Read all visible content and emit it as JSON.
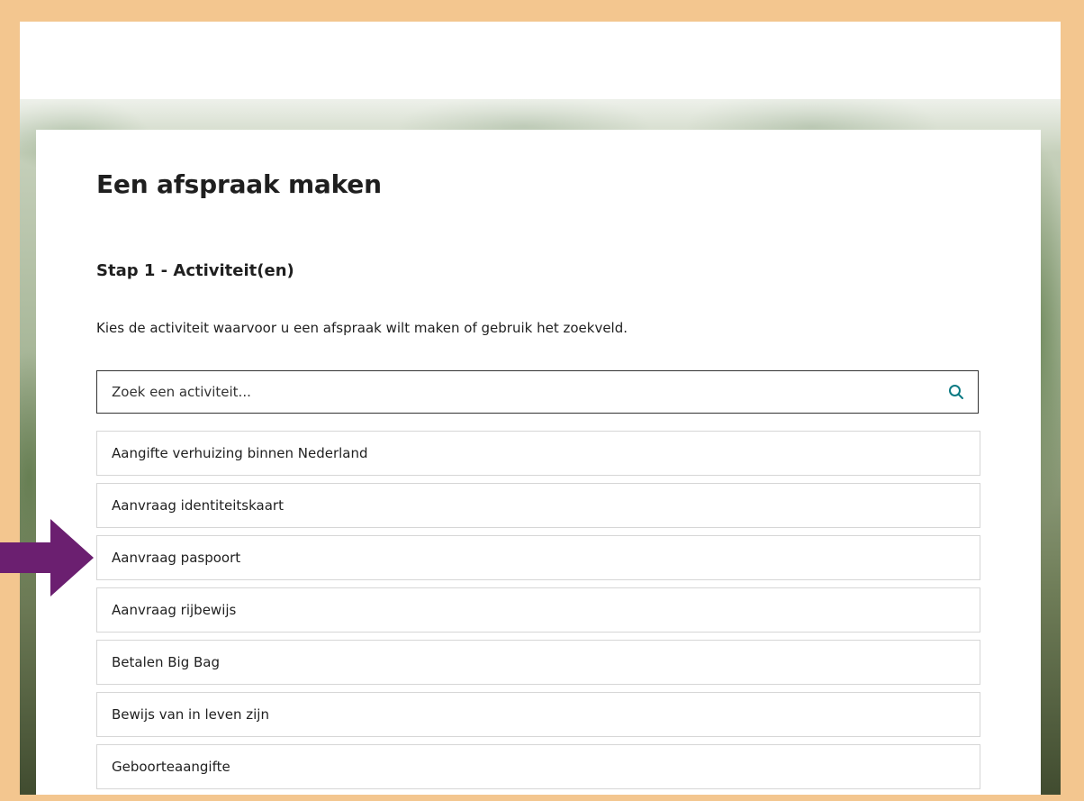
{
  "page": {
    "title": "Een afspraak maken",
    "step_title": "Stap 1 - Activiteit(en)",
    "instruction": "Kies de activiteit waarvoor u een afspraak wilt maken of gebruik het zoekveld."
  },
  "search": {
    "placeholder": "Zoek een activiteit...",
    "value": "",
    "icon": "search-icon"
  },
  "activities": [
    {
      "label": "Aangifte verhuizing binnen Nederland"
    },
    {
      "label": "Aanvraag identiteitskaart"
    },
    {
      "label": "Aanvraag paspoort"
    },
    {
      "label": "Aanvraag rijbewijs"
    },
    {
      "label": "Betalen Big Bag"
    },
    {
      "label": "Bewijs van in leven zijn"
    },
    {
      "label": "Geboorteaangifte"
    }
  ],
  "annotation": {
    "icon": "arrow-right-icon",
    "color": "#6b1f70",
    "points_to": "Aanvraag paspoort"
  },
  "colors": {
    "frame": "#f3c68f",
    "accent": "#0b7a83",
    "text": "#1f1f1f",
    "item_border": "#d6d6d6"
  }
}
